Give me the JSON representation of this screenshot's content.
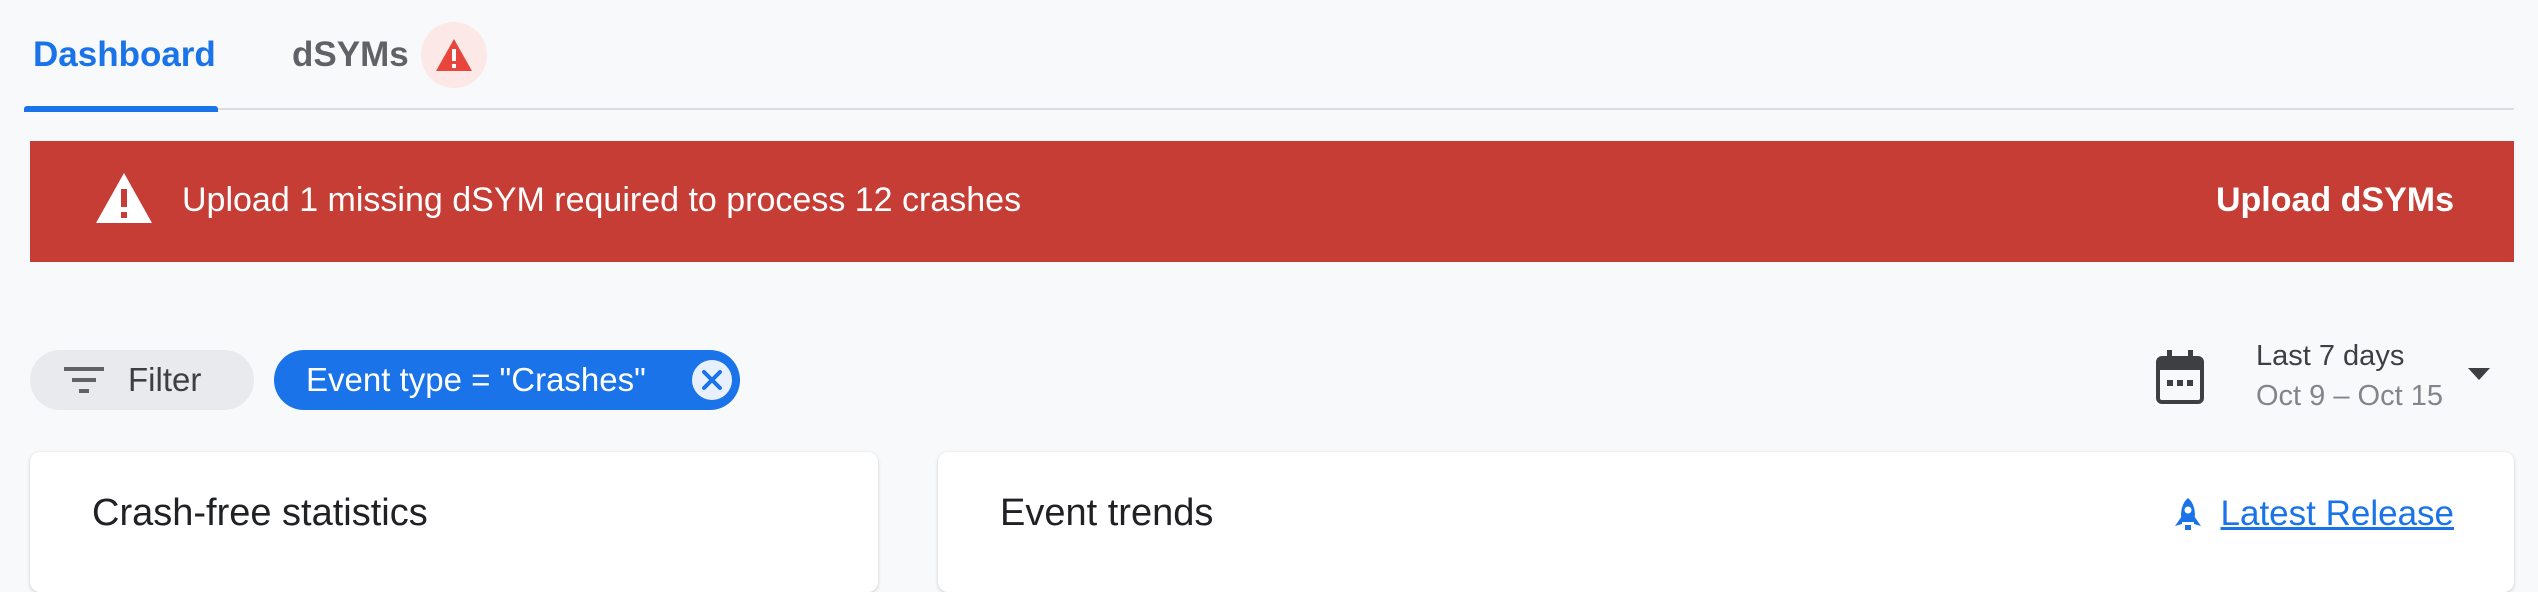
{
  "tabs": [
    {
      "label": "Dashboard",
      "active": true
    },
    {
      "label": "dSYMs",
      "active": false,
      "badge_icon": "warning-icon"
    }
  ],
  "banner": {
    "message": "Upload 1 missing dSYM required to process 12 crashes",
    "action_label": "Upload dSYMs",
    "icon": "warning-icon",
    "color": "#c53d35"
  },
  "filters": {
    "filter_label": "Filter",
    "active_chip": "Event type = \"Crashes\""
  },
  "date_range": {
    "label": "Last 7 days",
    "range": "Oct 9 – Oct 15"
  },
  "cards": {
    "crash_free_title": "Crash-free statistics",
    "event_trends_title": "Event trends",
    "latest_release_label": "Latest Release"
  },
  "colors": {
    "accent": "#1a73e8",
    "error": "#c53d35",
    "background": "#f8f9fa"
  }
}
